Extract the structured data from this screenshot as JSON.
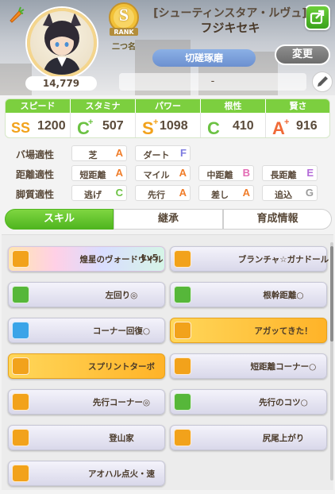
{
  "header": {
    "epithet": "[シューティンスタア・ルヴュ]",
    "character_name": "フジキセキ",
    "rank": "S",
    "rank_label": "RANK",
    "nickname_label": "二つ名",
    "nickname_value": "切磋琢磨",
    "change_button": "変更",
    "fans": "14,779",
    "comment": "-"
  },
  "stats": [
    {
      "label": "スピード",
      "grade": "SS+",
      "value": "1200",
      "color": "#f2a21b"
    },
    {
      "label": "スタミナ",
      "grade": "C+",
      "value": "507",
      "color": "#7dc84a"
    },
    {
      "label": "パワー",
      "grade": "S+",
      "value": "1098",
      "color": "#f2a21b"
    },
    {
      "label": "根性",
      "grade": "C",
      "value": "410",
      "color": "#7dc84a"
    },
    {
      "label": "賢さ",
      "grade": "A+",
      "value": "916",
      "color": "#f06a37"
    }
  ],
  "aptitude": {
    "rows": [
      {
        "label": "バ場適性",
        "cells": [
          {
            "name": "芝",
            "grade": "A"
          },
          {
            "name": "ダート",
            "grade": "F"
          }
        ]
      },
      {
        "label": "距離適性",
        "cells": [
          {
            "name": "短距離",
            "grade": "A"
          },
          {
            "name": "マイル",
            "grade": "A"
          },
          {
            "name": "中距離",
            "grade": "B"
          },
          {
            "name": "長距離",
            "grade": "E"
          }
        ]
      },
      {
        "label": "脚質適性",
        "cells": [
          {
            "name": "逃げ",
            "grade": "C"
          },
          {
            "name": "先行",
            "grade": "A"
          },
          {
            "name": "差し",
            "grade": "A"
          },
          {
            "name": "追込",
            "grade": "G"
          }
        ]
      }
    ]
  },
  "grade_colors": {
    "A": "#f07d2a",
    "B": "#e36ab4",
    "C": "#6cc243",
    "E": "#b36ad8",
    "F": "#7d7be0",
    "G": "#9a9a9a"
  },
  "tabs": [
    "スキル",
    "継承",
    "育成情報"
  ],
  "skills": [
    {
      "name": "煌星のヴォードヴィル",
      "level": "Lv5",
      "style": "rainbow",
      "icon": "running-horse-icon",
      "icon_color": "#f2a21b"
    },
    {
      "name": "ブランチャ☆ガナドール",
      "level": "",
      "style": "normal",
      "icon": "running-horse-icon",
      "icon_color": "#f2a21b"
    },
    {
      "name": "左回り◎",
      "level": "",
      "style": "normal",
      "icon": "field-icon",
      "icon_color": "#56b73a"
    },
    {
      "name": "根幹距離○",
      "level": "",
      "style": "normal",
      "icon": "heart-icon",
      "icon_color": "#56b73a"
    },
    {
      "name": "コーナー回復○",
      "level": "",
      "style": "normal",
      "icon": "recovery-icon",
      "icon_color": "#3aa4e8"
    },
    {
      "name": "アガッてきた！",
      "level": "",
      "style": "gold",
      "icon": "running-horse-icon",
      "icon_color": "#f2a21b"
    },
    {
      "name": "スプリントターボ",
      "level": "",
      "style": "gold",
      "icon": "running-horse-icon",
      "icon_color": "#f2a21b"
    },
    {
      "name": "短距離コーナー○",
      "level": "",
      "style": "normal",
      "icon": "running-horse-icon",
      "icon_color": "#f2a21b"
    },
    {
      "name": "先行コーナー◎",
      "level": "",
      "style": "normal",
      "icon": "running-horse-icon",
      "icon_color": "#f2a21b"
    },
    {
      "name": "先行のコツ○",
      "level": "",
      "style": "normal",
      "icon": "book-icon",
      "icon_color": "#56b73a"
    },
    {
      "name": "登山家",
      "level": "",
      "style": "normal",
      "icon": "running-horse-icon",
      "icon_color": "#f2a21b"
    },
    {
      "name": "尻尾上がり",
      "level": "",
      "style": "normal",
      "icon": "running-horse-icon",
      "icon_color": "#f2a21b"
    },
    {
      "name": "アオハル点火・速",
      "level": "",
      "style": "normal",
      "icon": "running-horse-icon",
      "icon_color": "#f2a21b"
    }
  ]
}
